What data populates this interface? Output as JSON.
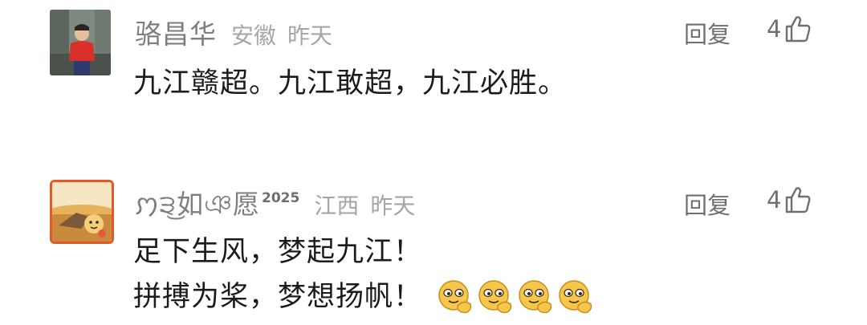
{
  "comments": [
    {
      "username": "骆昌华",
      "badge": "",
      "location": "安徽",
      "time": "昨天",
      "reply_label": "回复",
      "likes": "4",
      "lines": [
        "九江赣超。九江敢超，九江必胜。"
      ],
      "avatar_icon": "person-photo-avatar"
    },
    {
      "username": "ꩀ੩͜如ঞ愿",
      "badge": "2025",
      "location": "江西",
      "time": "昨天",
      "reply_label": "回复",
      "likes": "4",
      "lines": [
        "足下生风，梦起九江！",
        "拼搏为桨，梦想扬帆！"
      ],
      "emoji_count": 4,
      "emoji_icon": "rub-hands-emoji",
      "avatar_icon": "sunset-dog-avatar"
    }
  ],
  "colors": {
    "username": "#7e7e7e",
    "meta": "#a6a6a6",
    "action": "#6f6f6f",
    "text": "#1b1b1b",
    "avatar_border": "#e25a2a",
    "emoji_fill": "#f7c64a"
  }
}
